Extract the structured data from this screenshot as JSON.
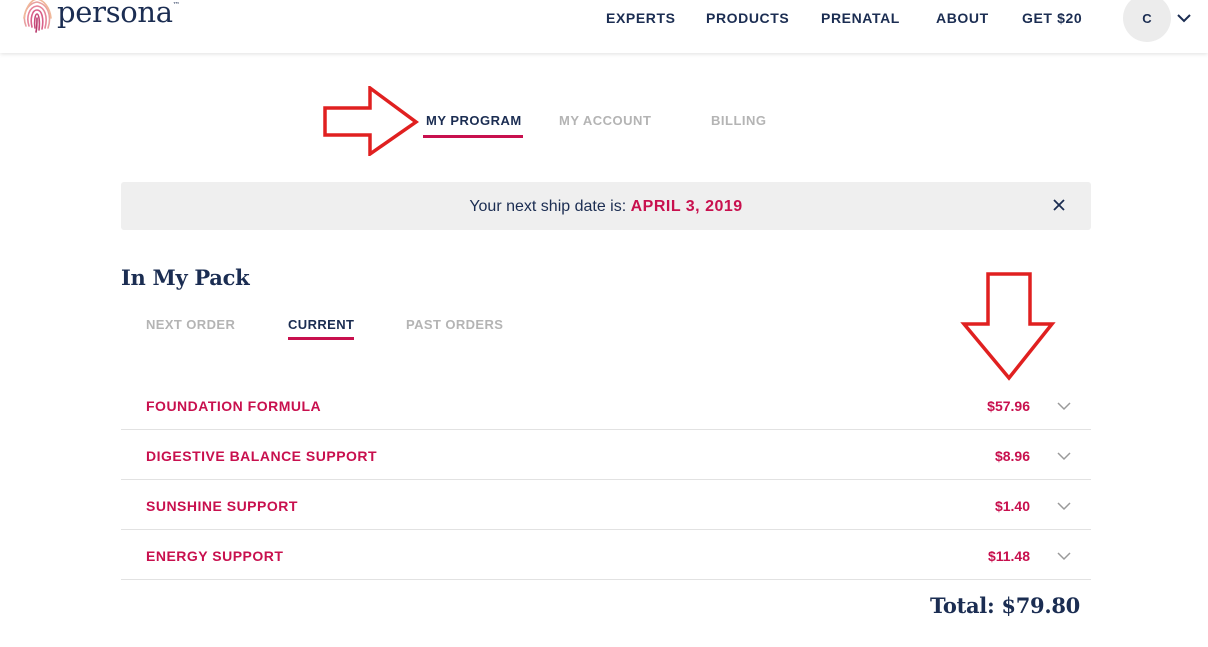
{
  "header": {
    "logo_text": "persona",
    "logo_tm": "™",
    "nav": [
      "EXPERTS",
      "PRODUCTS",
      "PRENATAL",
      "ABOUT",
      "GET $20"
    ],
    "avatar_initial": "C"
  },
  "program_tabs": [
    {
      "label": "MY PROGRAM",
      "active": true
    },
    {
      "label": "MY ACCOUNT",
      "active": false
    },
    {
      "label": "BILLING",
      "active": false
    }
  ],
  "banner": {
    "prefix": "Your next ship date is: ",
    "date": "APRIL 3, 2019"
  },
  "pack": {
    "title": "In My Pack",
    "tabs": [
      {
        "label": "NEXT ORDER",
        "active": false
      },
      {
        "label": "CURRENT",
        "active": true
      },
      {
        "label": "PAST ORDERS",
        "active": false
      }
    ],
    "items": [
      {
        "name": "FOUNDATION FORMULA",
        "price": "$57.96"
      },
      {
        "name": "DIGESTIVE BALANCE SUPPORT",
        "price": "$8.96"
      },
      {
        "name": "SUNSHINE SUPPORT",
        "price": "$1.40"
      },
      {
        "name": "ENERGY SUPPORT",
        "price": "$11.48"
      }
    ],
    "total": "Total: $79.80"
  },
  "colors": {
    "accent": "#c8104e",
    "navy": "#1b2d52",
    "muted": "#b4b4b4",
    "banner_bg": "#efefef",
    "annotation": "#e02020"
  },
  "icons": {
    "logo": "fingerprint-logo-icon",
    "avatar_menu": "chevron-down-icon",
    "banner_close": "close-icon",
    "row_expand": "chevron-down-icon",
    "annotation_right": "red-arrow-right-icon",
    "annotation_down": "red-arrow-down-icon"
  }
}
